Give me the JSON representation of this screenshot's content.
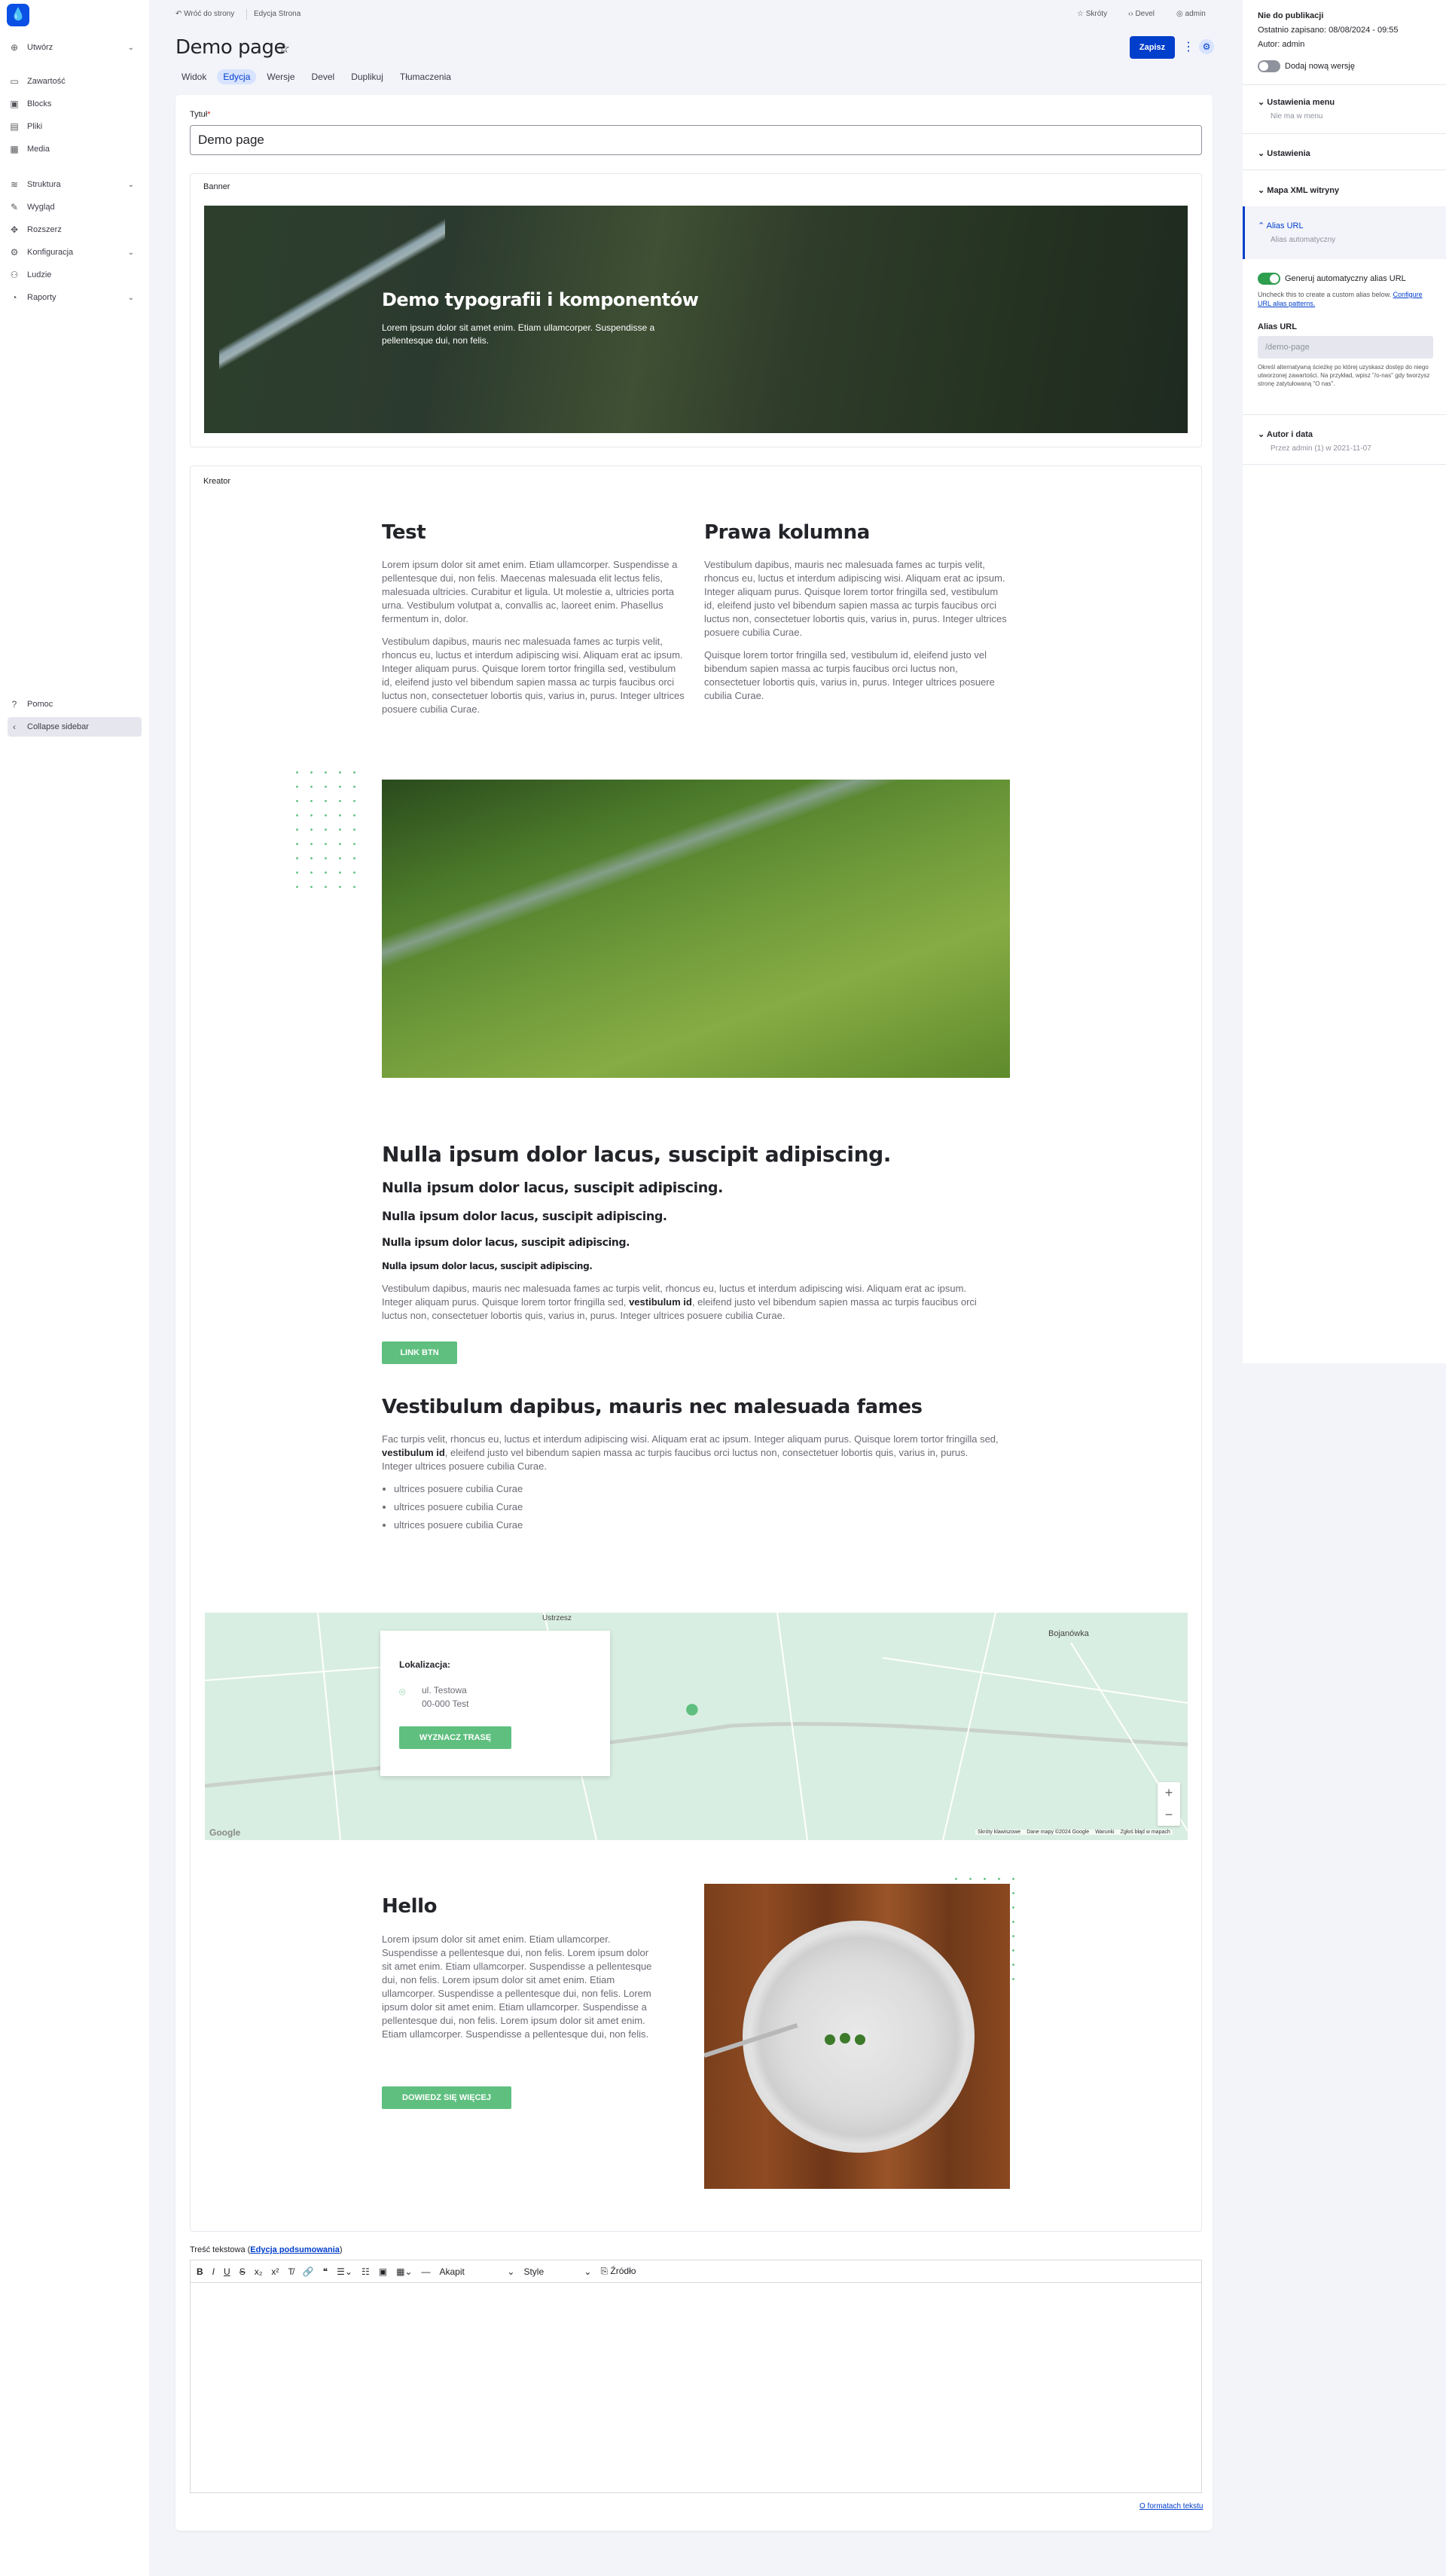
{
  "sidebar": {
    "items": [
      {
        "label": "Utwórz",
        "icon": "plus-circle-icon"
      },
      {
        "label": "Zawartość",
        "icon": "file-icon"
      },
      {
        "label": "Blocks",
        "icon": "blocks-icon"
      },
      {
        "label": "Pliki",
        "icon": "folder-icon"
      },
      {
        "label": "Media",
        "icon": "media-icon"
      },
      {
        "label": "Struktura",
        "icon": "structure-icon"
      },
      {
        "label": "Wygląd",
        "icon": "brush-icon"
      },
      {
        "label": "Rozszerz",
        "icon": "puzzle-icon"
      },
      {
        "label": "Konfiguracja",
        "icon": "gear-icon"
      },
      {
        "label": "Ludzie",
        "icon": "people-icon"
      },
      {
        "label": "Raporty",
        "icon": "chart-icon"
      }
    ],
    "help": "Pomoc",
    "collapse": "Collapse sidebar"
  },
  "topbar": {
    "back": "Wróć do strony",
    "breadcrumb": "Edycja Strona",
    "shortcuts": "Skróty",
    "devel": "Devel",
    "user": "admin"
  },
  "page": {
    "title": "Demo page",
    "tabs": [
      "Widok",
      "Edycja",
      "Wersje",
      "Devel",
      "Duplikuj",
      "Tłumaczenia"
    ],
    "save": "Zapisz"
  },
  "form": {
    "title_label": "Tytuł",
    "title_value": "Demo page",
    "banner_label": "Banner",
    "banner_heading": "Demo typografii i komponentów",
    "banner_text": "Lorem ipsum dolor sit amet enim. Etiam ullamcorper. Suspendisse a pellentesque dui, non felis.",
    "kreator_label": "Kreator",
    "col1_title": "Test",
    "col1_p1": "Lorem ipsum dolor sit amet enim. Etiam ullamcorper. Suspendisse a pellentesque dui, non felis. Maecenas malesuada elit lectus felis, malesuada ultricies. Curabitur et ligula. Ut molestie a, ultricies porta urna. Vestibulum volutpat a, convallis ac, laoreet enim. Phasellus fermentum in, dolor.",
    "col1_p2": "Vestibulum dapibus, mauris nec malesuada fames ac turpis velit, rhoncus eu, luctus et interdum adipiscing wisi. Aliquam erat ac ipsum. Integer aliquam purus. Quisque lorem tortor fringilla sed, vestibulum id, eleifend justo vel bibendum sapien massa ac turpis faucibus orci luctus non, consectetuer lobortis quis, varius in, purus. Integer ultrices posuere cubilia Curae.",
    "col2_title": "Prawa kolumna",
    "col2_p1": "Vestibulum dapibus, mauris nec malesuada fames ac turpis velit, rhoncus eu, luctus et interdum adipiscing wisi. Aliquam erat ac ipsum. Integer aliquam purus. Quisque lorem tortor fringilla sed, vestibulum id, eleifend justo vel bibendum sapien massa ac turpis faucibus orci luctus non, consectetuer lobortis quis, varius in, purus. Integer ultrices posuere cubilia Curae.",
    "col2_p2": "Quisque lorem tortor fringilla sed, vestibulum id, eleifend justo vel bibendum sapien massa ac turpis faucibus orci luctus non, consectetuer lobortis quis, varius in, purus. Integer ultrices posuere cubilia Curae.",
    "h1": "Nulla ipsum dolor lacus, suscipit adipiscing.",
    "h2": "Nulla ipsum dolor lacus, suscipit adipiscing.",
    "h3": "Nulla ipsum dolor lacus, suscipit adipiscing.",
    "h4": "Nulla ipsum dolor lacus, suscipit adipiscing.",
    "h5": "Nulla ipsum dolor lacus, suscipit adipiscing.",
    "typo_p_a": "Vestibulum dapibus, mauris nec malesuada fames ac turpis velit, rhoncus eu, luctus et interdum adipiscing wisi. Aliquam erat ac ipsum. Integer aliquam purus. Quisque lorem tortor fringilla sed,",
    "typo_p_bold": "vestibulum id",
    "typo_p_b": ", eleifend justo vel bibendum sapien massa ac turpis faucibus orci luctus non, consectetuer lobortis quis, varius in, purus. Integer ultrices posuere cubilia Curae.",
    "link_btn": "LINK BTN",
    "section2_title": "Vestibulum dapibus, mauris nec malesuada fames",
    "section2_p_a": "Fac turpis velit, rhoncus eu, luctus et interdum adipiscing wisi. Aliquam erat ac ipsum. Integer aliquam purus. Quisque lorem tortor fringilla sed,",
    "section2_p_bold": "vestibulum id",
    "section2_p_b": ", eleifend justo vel bibendum sapien massa ac turpis faucibus orci luctus non, consectetuer lobortis quis, varius in, purus. Integer ultrices posuere cubilia Curae.",
    "list": [
      "ultrices posuere cubilia Curae",
      "ultrices posuere cubilia Curae",
      "ultrices posuere cubilia Curae"
    ],
    "map": {
      "title": "Lokalizacja:",
      "line1": "ul. Testowa",
      "line2": "00-000 Test",
      "btn": "WYZNACZ TRASĘ",
      "place1": "Ustrzesz",
      "place2": "Bojanówka",
      "google": "Google",
      "footer": [
        "Skróty klawiszowe",
        "Dane mapy ©2024 Google",
        "Warunki",
        "Zgłoś błąd w mapach"
      ],
      "zoom_in": "+",
      "zoom_out": "−"
    },
    "hello_title": "Hello",
    "hello_text": "Lorem ipsum dolor sit amet enim. Etiam ullamcorper. Suspendisse a pellentesque dui, non felis. Lorem ipsum dolor sit amet enim. Etiam ullamcorper. Suspendisse a pellentesque dui, non felis. Lorem ipsum dolor sit amet enim. Etiam ullamcorper. Suspendisse a pellentesque dui, non felis. Lorem ipsum dolor sit amet enim. Etiam ullamcorper. Suspendisse a pellentesque dui, non felis. Lorem ipsum dolor sit amet enim. Etiam ullamcorper. Suspendisse a pellentesque dui, non felis.",
    "hello_btn": "DOWIEDZ SIĘ WIĘCEJ",
    "body_label": "Treść tekstowa",
    "body_summary_link": "Edycja podsumowania",
    "toolbar": {
      "format": "Akapit",
      "style": "Style",
      "source": "Źródło"
    },
    "formats_link": "O formatach tekstu"
  },
  "rightbar": {
    "status": "Nie do publikacji",
    "saved": "Ostatnio zapisano: 08/08/2024 - 09:55",
    "author": "Autor: admin",
    "new_revision": "Dodaj nową wersję",
    "menu_title": "Ustawienia menu",
    "menu_sub": "Nie ma w menu",
    "settings": "Ustawienia",
    "sitemap": "Mapa XML witryny",
    "alias_title": "Alias URL",
    "alias_sub": "Alias automatyczny",
    "auto_alias": "Generuj automatyczny alias URL",
    "auto_alias_help_a": "Uncheck this to create a custom alias below. ",
    "auto_alias_help_link": "Configure URL alias patterns.",
    "alias_label": "Alias URL",
    "alias_value": "/demo-page",
    "alias_help": "Określ alternatywną ścieżkę po której uzyskasz dostęp do niego utworzonej zawartości. Na przykład, wpisz \"/o-nas\" gdy tworzysz stronę zatytułowaną \"O nas\".",
    "author_title": "Autor i data",
    "author_sub": "Przez admin (1) w 2021-11-07"
  },
  "colors": {
    "accent": "#003ecc",
    "green": "#5fbf7f",
    "map": "#d9eee2"
  }
}
